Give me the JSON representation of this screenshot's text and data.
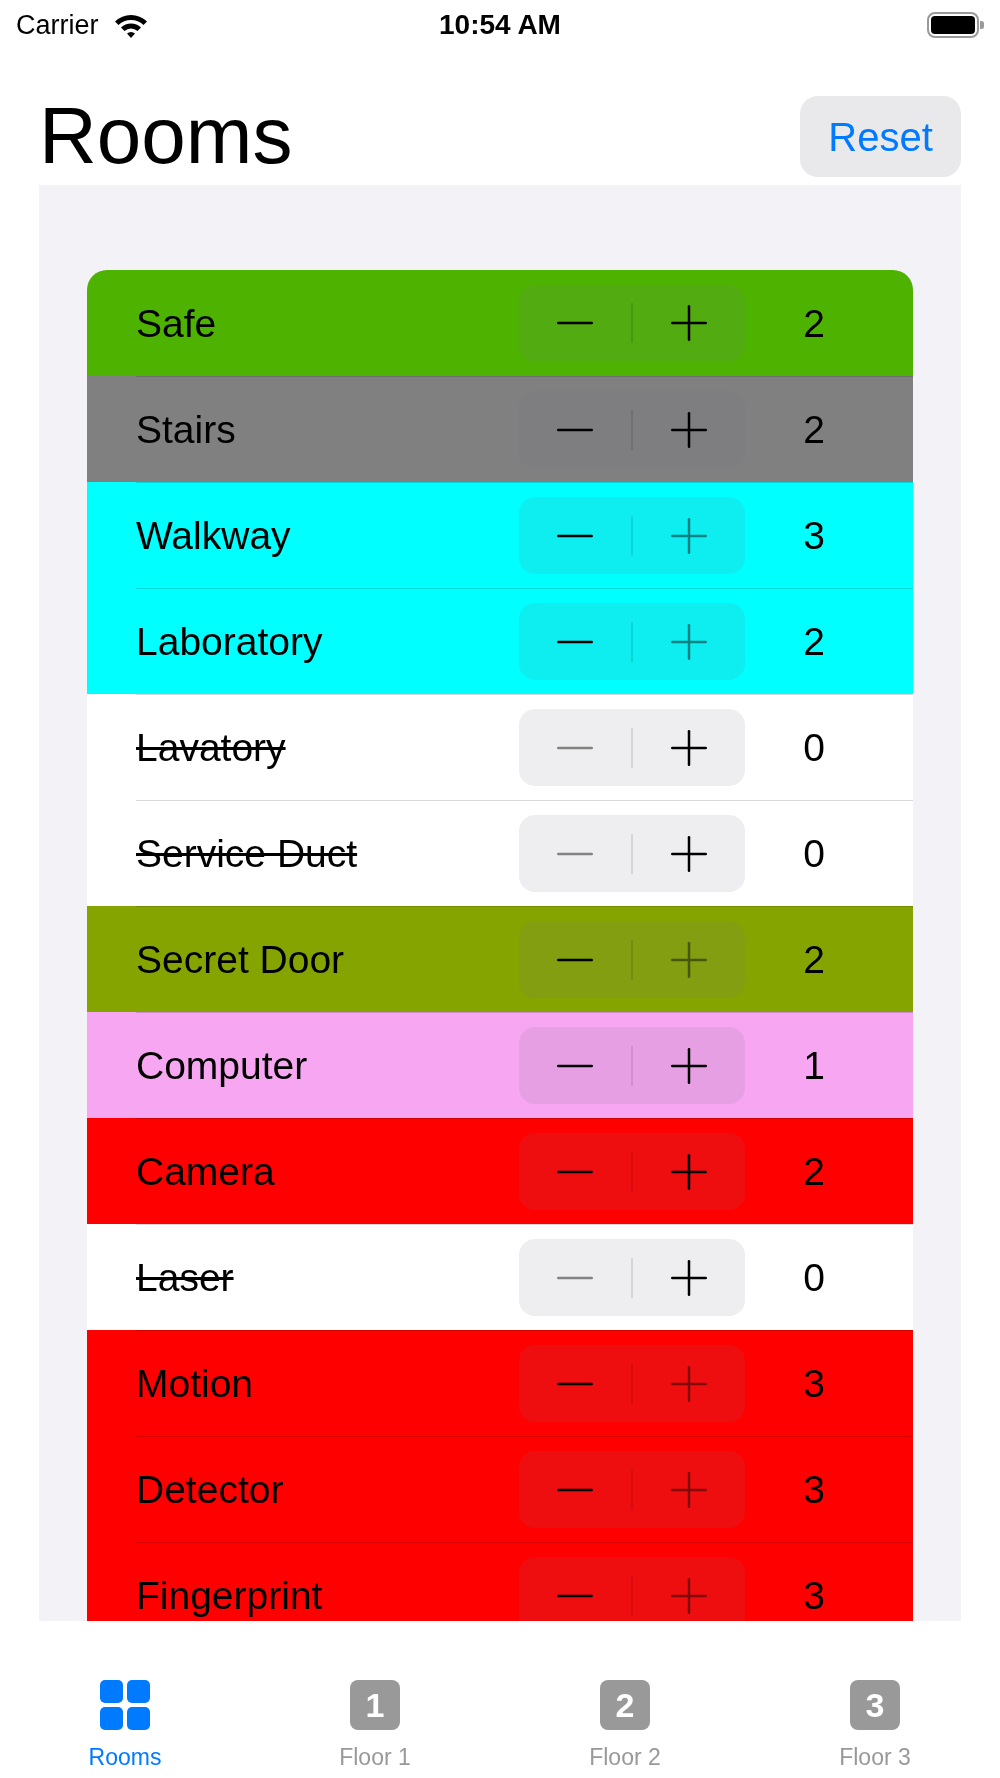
{
  "status_bar": {
    "carrier": "Carrier",
    "time": "10:54 AM"
  },
  "header": {
    "title": "Rooms",
    "reset_button": "Reset"
  },
  "rooms": [
    {
      "name": "Safe",
      "count": "2",
      "color": "#4eb300",
      "struck": false,
      "decrement_disabled": false,
      "increment_disabled": false
    },
    {
      "name": "Stairs",
      "count": "2",
      "color": "#808080",
      "struck": false,
      "decrement_disabled": false,
      "increment_disabled": false
    },
    {
      "name": "Walkway",
      "count": "3",
      "color": "#00ffff",
      "struck": false,
      "decrement_disabled": false,
      "increment_disabled": true
    },
    {
      "name": "Laboratory",
      "count": "2",
      "color": "#00ffff",
      "struck": false,
      "decrement_disabled": false,
      "increment_disabled": true
    },
    {
      "name": "Lavatory",
      "count": "0",
      "color": "#ffffff",
      "struck": true,
      "decrement_disabled": true,
      "increment_disabled": false
    },
    {
      "name": "Service Duct",
      "count": "0",
      "color": "#ffffff",
      "struck": true,
      "decrement_disabled": true,
      "increment_disabled": false
    },
    {
      "name": "Secret Door",
      "count": "2",
      "color": "#86a400",
      "struck": false,
      "decrement_disabled": false,
      "increment_disabled": true
    },
    {
      "name": "Computer",
      "count": "1",
      "color": "#f7a6f2",
      "struck": false,
      "decrement_disabled": false,
      "increment_disabled": false
    },
    {
      "name": "Camera",
      "count": "2",
      "color": "#ff0000",
      "struck": false,
      "decrement_disabled": false,
      "increment_disabled": false
    },
    {
      "name": "Laser",
      "count": "0",
      "color": "#ffffff",
      "struck": true,
      "decrement_disabled": true,
      "increment_disabled": false
    },
    {
      "name": "Motion",
      "count": "3",
      "color": "#ff0000",
      "struck": false,
      "decrement_disabled": false,
      "increment_disabled": true
    },
    {
      "name": "Detector",
      "count": "3",
      "color": "#ff0000",
      "struck": false,
      "decrement_disabled": false,
      "increment_disabled": true
    },
    {
      "name": "Fingerprint",
      "count": "3",
      "color": "#ff0000",
      "struck": false,
      "decrement_disabled": false,
      "increment_disabled": true
    }
  ],
  "tabs": [
    {
      "kind": "grid",
      "label": "Rooms",
      "selected": true
    },
    {
      "kind": "number",
      "number": "1",
      "label": "Floor 1",
      "selected": false
    },
    {
      "kind": "number",
      "number": "2",
      "label": "Floor 2",
      "selected": false
    },
    {
      "kind": "number",
      "number": "3",
      "label": "Floor 3",
      "selected": false
    }
  ]
}
